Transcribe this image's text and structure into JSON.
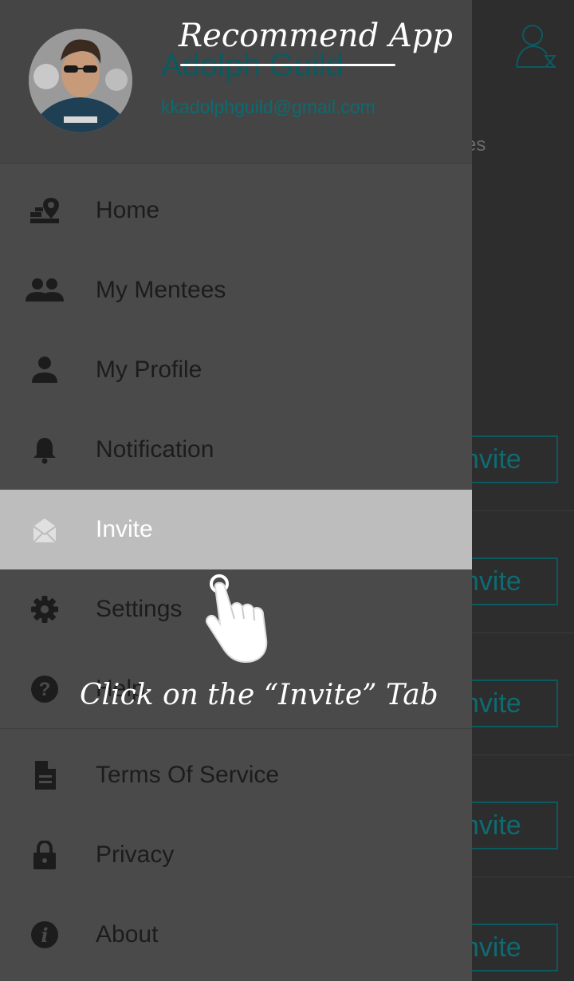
{
  "background": {
    "partial_text": "es",
    "invite_buttons": [
      "nvite",
      "nvite",
      "nvite",
      "nvite",
      "nvite"
    ]
  },
  "drawer": {
    "user": {
      "name": "Adolph Guild",
      "email": "kkadolphguild@gmail.com"
    },
    "menu": [
      {
        "label": "Home",
        "icon": "home-map-icon"
      },
      {
        "label": "My Mentees",
        "icon": "group-icon"
      },
      {
        "label": "My Profile",
        "icon": "person-icon"
      },
      {
        "label": "Notification",
        "icon": "bell-icon"
      },
      {
        "label": "Invite",
        "icon": "mail-icon",
        "active": true
      },
      {
        "label": "Settings",
        "icon": "gear-icon"
      },
      {
        "label": "Help",
        "icon": "help-icon"
      },
      {
        "label": "Terms Of Service",
        "icon": "document-icon"
      },
      {
        "label": "Privacy",
        "icon": "lock-icon"
      },
      {
        "label": "About",
        "icon": "info-icon"
      }
    ]
  },
  "overlay": {
    "title": "Recommend App",
    "hint": "Click on the “Invite” Tab"
  },
  "colors": {
    "drawer_bg": "#4a4a4a",
    "active_item_bg": "#bdbdbd",
    "accent_teal": "#0b5a60"
  }
}
